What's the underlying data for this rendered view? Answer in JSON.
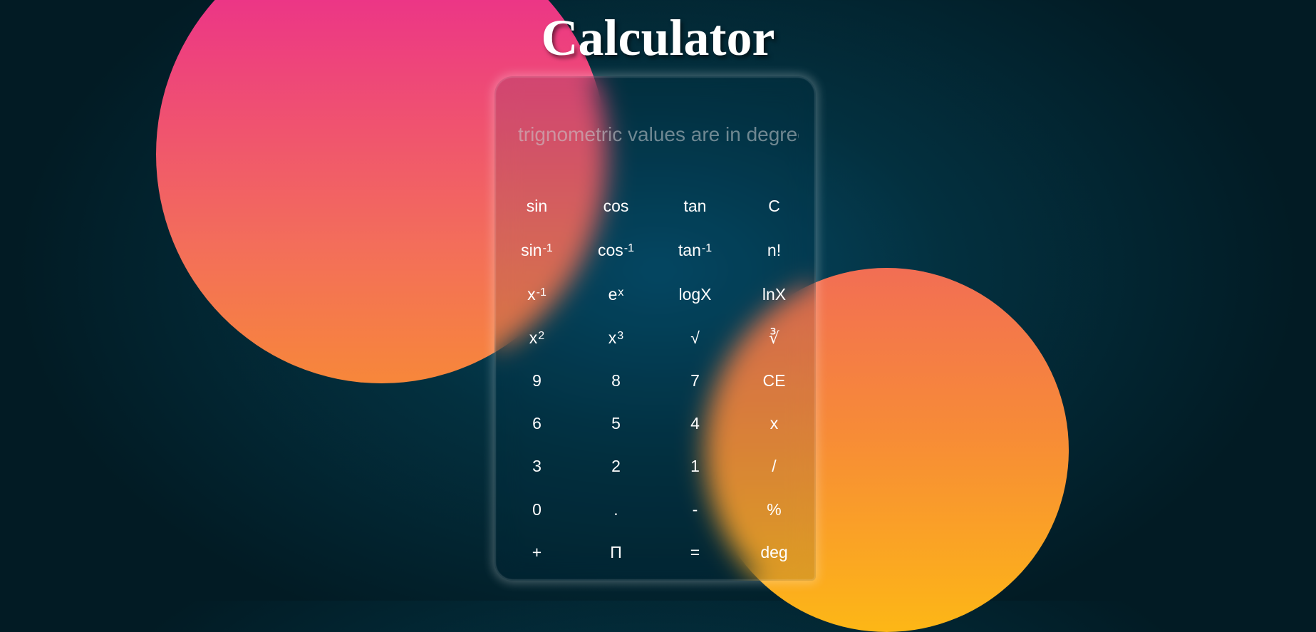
{
  "title": "Calculator",
  "display": {
    "placeholder": "trignometric values are in degree",
    "value": ""
  },
  "colors": {
    "background": "#03303f",
    "blob_pink_top": "#ea2593",
    "blob_pink_bottom": "#f7873a",
    "blob_orange_top": "#f26e54",
    "blob_orange_bottom": "#fdb716",
    "text": "#ffffff"
  },
  "keys": [
    {
      "base": "sin",
      "sup": ""
    },
    {
      "base": "cos",
      "sup": ""
    },
    {
      "base": "tan",
      "sup": ""
    },
    {
      "base": "C",
      "sup": ""
    },
    {
      "base": "sin",
      "sup": "-1"
    },
    {
      "base": "cos",
      "sup": "-1"
    },
    {
      "base": "tan",
      "sup": "-1"
    },
    {
      "base": "n!",
      "sup": ""
    },
    {
      "base": "x",
      "sup": "-1"
    },
    {
      "base": "e",
      "sup": "x"
    },
    {
      "base": "logX",
      "sup": ""
    },
    {
      "base": "lnX",
      "sup": ""
    },
    {
      "base": "x",
      "sup": "2"
    },
    {
      "base": "x",
      "sup": "3"
    },
    {
      "base": "√",
      "sup": ""
    },
    {
      "base": "∛",
      "sup": ""
    },
    {
      "base": "9",
      "sup": ""
    },
    {
      "base": "8",
      "sup": ""
    },
    {
      "base": "7",
      "sup": ""
    },
    {
      "base": "CE",
      "sup": ""
    },
    {
      "base": "6",
      "sup": ""
    },
    {
      "base": "5",
      "sup": ""
    },
    {
      "base": "4",
      "sup": ""
    },
    {
      "base": "x",
      "sup": ""
    },
    {
      "base": "3",
      "sup": ""
    },
    {
      "base": "2",
      "sup": ""
    },
    {
      "base": "1",
      "sup": ""
    },
    {
      "base": "/",
      "sup": ""
    },
    {
      "base": "0",
      "sup": ""
    },
    {
      "base": ".",
      "sup": ""
    },
    {
      "base": "-",
      "sup": ""
    },
    {
      "base": "%",
      "sup": ""
    },
    {
      "base": "+",
      "sup": ""
    },
    {
      "base": "Π",
      "sup": ""
    },
    {
      "base": "=",
      "sup": ""
    },
    {
      "base": "deg",
      "sup": ""
    }
  ]
}
